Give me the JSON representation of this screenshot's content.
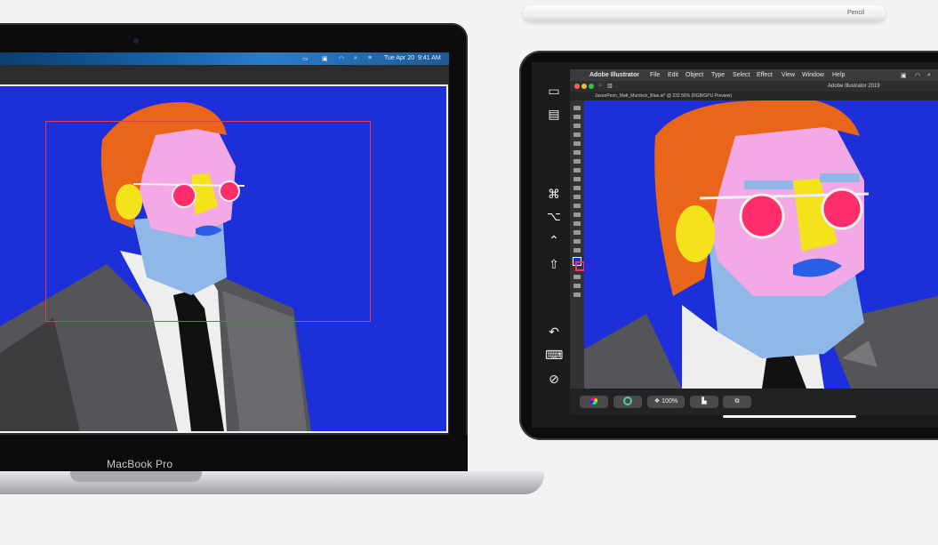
{
  "macbook": {
    "brand_label": "MacBook Pro",
    "menubar": {
      "clock_date": "Tue Apr 20",
      "clock_time": "9:41 AM"
    }
  },
  "pencil": {
    "label": "Pencil"
  },
  "ipad": {
    "illustrator": {
      "app_menu": "Adobe Illustrator",
      "menus": [
        "File",
        "Edit",
        "Object",
        "Type",
        "Select",
        "Effect",
        "View",
        "Window",
        "Help"
      ],
      "window_title": "Adobe Illustrator 2019",
      "doc_tab": "JasonPenn_Matt_Murdock_Blue.ai* @ 232.56% (RGB/GPU Preview)"
    },
    "bottom_toolbar": {
      "zoom_label": "100%"
    },
    "sidecar_icons": [
      "sidebar-toggle-icon",
      "show-menu-icon",
      "command-key-icon",
      "option-key-icon",
      "control-key-icon",
      "shift-key-icon",
      "undo-icon",
      "keyboard-icon",
      "disconnect-icon"
    ]
  },
  "colors": {
    "artboard_blue": "#1d2fd8",
    "hair": "#e8651a",
    "skin": "#f2a9e6",
    "beard": "#8fb7e8",
    "lens": "#ff2d6b",
    "selection": "#e23b56"
  }
}
